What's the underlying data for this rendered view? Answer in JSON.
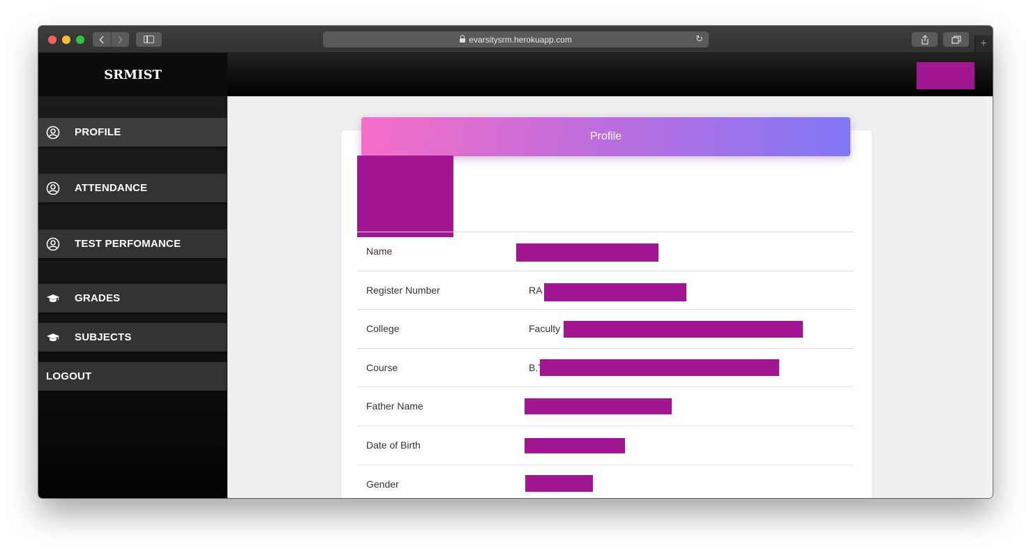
{
  "browser": {
    "url": "evarsitysrm.herokuapp.com"
  },
  "sidebar": {
    "brand": "SRMIST",
    "items": [
      {
        "label": "PROFILE",
        "icon": "user-circle-icon"
      },
      {
        "label": "ATTENDANCE",
        "icon": "user-circle-icon"
      },
      {
        "label": "TEST PERFOMANCE",
        "icon": "user-circle-icon"
      },
      {
        "label": "GRADES",
        "icon": "graduation-cap-icon"
      },
      {
        "label": "SUBJECTS",
        "icon": "graduation-cap-icon"
      },
      {
        "label": "LOGOUT",
        "icon": ""
      }
    ]
  },
  "profile": {
    "title": "Profile",
    "fields": [
      {
        "label": "Name",
        "value_prefix": ""
      },
      {
        "label": "Register Number",
        "value_prefix": "RA"
      },
      {
        "label": "College",
        "value_prefix": "Faculty"
      },
      {
        "label": "Course",
        "value_prefix": "B.T"
      },
      {
        "label": "Father Name",
        "value_prefix": ""
      },
      {
        "label": "Date of Birth",
        "value_prefix": ""
      },
      {
        "label": "Gender",
        "value_prefix": ""
      }
    ]
  },
  "colors": {
    "redaction": "#a21692",
    "header_gradient_start": "#f66ec6",
    "header_gradient_end": "#7f77f5",
    "sidebar_item_bg": "#333333"
  }
}
